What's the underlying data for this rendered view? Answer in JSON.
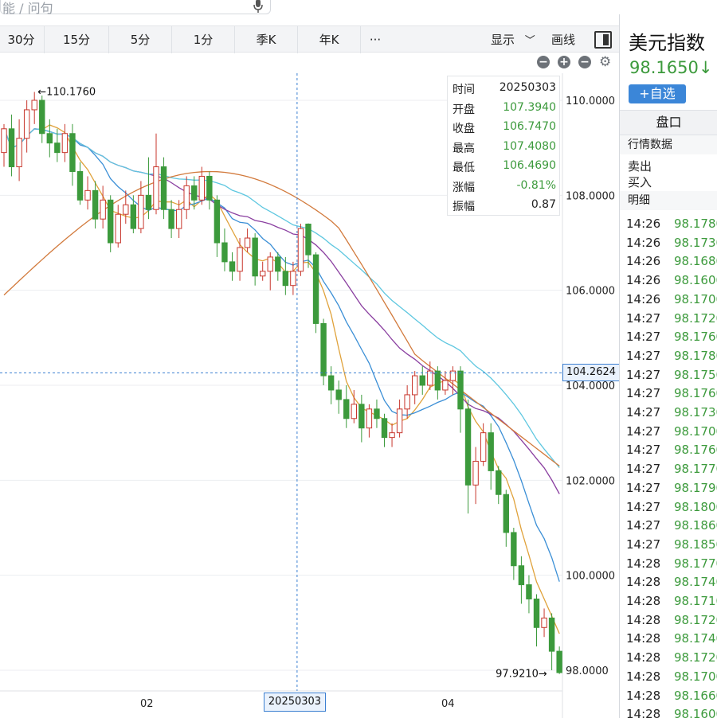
{
  "search": {
    "placeholder": "能 / 问句"
  },
  "toolbar": {
    "periods": [
      "30分",
      "15分",
      "5分",
      "1分",
      "季K",
      "年K",
      "···"
    ],
    "display_label": "显示",
    "display_arrow": "﹀",
    "draw_label": "画线"
  },
  "zoom_controls": {
    "zoom_out": "−",
    "zoom_in": "+",
    "collapse": "−"
  },
  "instrument": {
    "name": "美元指数",
    "price": "98.1650",
    "arrow": "↓",
    "add_watchlist": "+自选",
    "tab": "盘口",
    "quotes_section": "行情数据",
    "sell_label": "卖出",
    "buy_label": "买入",
    "detail_section": "明细"
  },
  "ticks": [
    {
      "time": "14:26",
      "price": "98.1780"
    },
    {
      "time": "14:26",
      "price": "98.1730"
    },
    {
      "time": "14:26",
      "price": "98.1680"
    },
    {
      "time": "14:26",
      "price": "98.1600"
    },
    {
      "time": "14:26",
      "price": "98.1700"
    },
    {
      "time": "14:27",
      "price": "98.1720"
    },
    {
      "time": "14:27",
      "price": "98.1760"
    },
    {
      "time": "14:27",
      "price": "98.1780"
    },
    {
      "time": "14:27",
      "price": "98.1750"
    },
    {
      "time": "14:27",
      "price": "98.1760"
    },
    {
      "time": "14:27",
      "price": "98.1730"
    },
    {
      "time": "14:27",
      "price": "98.1700"
    },
    {
      "time": "14:27",
      "price": "98.1760"
    },
    {
      "time": "14:27",
      "price": "98.1770"
    },
    {
      "time": "14:27",
      "price": "98.1790"
    },
    {
      "time": "14:27",
      "price": "98.1800"
    },
    {
      "time": "14:27",
      "price": "98.1860"
    },
    {
      "time": "14:27",
      "price": "98.1850"
    },
    {
      "time": "14:28",
      "price": "98.1770"
    },
    {
      "time": "14:28",
      "price": "98.1740"
    },
    {
      "time": "14:28",
      "price": "98.1710"
    },
    {
      "time": "14:28",
      "price": "98.1720"
    },
    {
      "time": "14:28",
      "price": "98.1740"
    },
    {
      "time": "14:28",
      "price": "98.1720"
    },
    {
      "time": "14:28",
      "price": "98.1700"
    },
    {
      "time": "14:28",
      "price": "98.1660"
    },
    {
      "time": "14:28",
      "price": "98.1600"
    }
  ],
  "info_box": {
    "rows": [
      {
        "label": "时间",
        "value": "20250303"
      },
      {
        "label": "开盘",
        "value": "107.3940"
      },
      {
        "label": "收盘",
        "value": "106.7470"
      },
      {
        "label": "最高",
        "value": "107.4080"
      },
      {
        "label": "最低",
        "value": "106.4690"
      },
      {
        "label": "涨幅",
        "value": "-0.81%"
      },
      {
        "label": "振幅",
        "value": "0.87"
      }
    ]
  },
  "crosshair": {
    "price": "104.2624",
    "date": "20250303",
    "price_value": 104.2624
  },
  "colors": {
    "up": "#c8372d",
    "down": "#3c9a3c",
    "ma5": "#e0a23b",
    "ma10": "#3b8fd6",
    "ma20": "#8a3fa0",
    "ma30": "#5ec7e0",
    "ma60": "#d27a3c",
    "accent": "#3b86d8"
  },
  "chart_data": {
    "type": "candlestick",
    "y_axis_labels": [
      "110.0000",
      "108.0000",
      "106.0000",
      "104.0000",
      "102.0000",
      "100.0000",
      "98.0000"
    ],
    "ylim": [
      97.5,
      110.6
    ],
    "x_axis_labels": [
      "02",
      "04"
    ],
    "high_annotation": "←110.1760",
    "low_annotation": "97.9210→",
    "high_value": 110.176,
    "low_value": 97.921,
    "candles": [
      [
        108.9,
        109.4,
        109.5,
        108.6
      ],
      [
        109.4,
        108.6,
        109.7,
        108.4
      ],
      [
        108.6,
        109.2,
        109.6,
        108.3
      ],
      [
        109.2,
        109.8,
        110.0,
        108.9
      ],
      [
        109.8,
        110.0,
        110.176,
        109.5
      ],
      [
        110.0,
        109.3,
        110.1,
        109.1
      ],
      [
        109.3,
        109.1,
        109.6,
        108.8
      ],
      [
        109.1,
        108.9,
        109.4,
        108.7
      ],
      [
        108.9,
        109.3,
        109.5,
        108.7
      ],
      [
        109.3,
        108.5,
        109.5,
        108.2
      ],
      [
        108.5,
        107.9,
        108.7,
        107.8
      ],
      [
        107.9,
        108.1,
        108.4,
        107.7
      ],
      [
        108.1,
        107.5,
        108.3,
        107.3
      ],
      [
        107.5,
        107.9,
        108.2,
        107.3
      ],
      [
        107.9,
        107.0,
        108.0,
        106.8
      ],
      [
        107.0,
        107.6,
        107.8,
        106.9
      ],
      [
        107.6,
        107.8,
        108.1,
        107.4
      ],
      [
        107.8,
        107.3,
        108.0,
        107.2
      ],
      [
        107.3,
        108.0,
        108.3,
        107.2
      ],
      [
        108.0,
        107.7,
        108.8,
        107.5
      ],
      [
        107.7,
        108.6,
        109.3,
        107.6
      ],
      [
        108.6,
        107.7,
        108.8,
        107.5
      ],
      [
        107.7,
        107.3,
        107.9,
        107.1
      ],
      [
        107.3,
        107.7,
        107.9,
        107.1
      ],
      [
        107.7,
        108.2,
        108.4,
        107.5
      ],
      [
        108.2,
        107.9,
        108.4,
        107.7
      ],
      [
        107.9,
        108.4,
        108.6,
        107.8
      ],
      [
        108.4,
        107.9,
        108.5,
        107.7
      ],
      [
        107.9,
        107.0,
        108.0,
        106.7
      ],
      [
        107.0,
        106.6,
        107.3,
        106.4
      ],
      [
        106.6,
        106.4,
        106.8,
        106.2
      ],
      [
        106.4,
        106.9,
        107.1,
        106.2
      ],
      [
        106.9,
        107.1,
        107.3,
        106.8
      ],
      [
        107.1,
        106.3,
        107.2,
        106.1
      ],
      [
        106.3,
        106.4,
        106.6,
        106.2
      ],
      [
        106.4,
        106.7,
        106.8,
        106.0
      ],
      [
        106.7,
        106.4,
        106.8,
        106.2
      ],
      [
        106.4,
        106.1,
        106.7,
        105.9
      ],
      [
        106.1,
        106.4,
        106.6,
        105.9
      ],
      [
        106.4,
        107.3,
        107.4,
        106.3
      ],
      [
        107.394,
        106.747,
        107.408,
        106.469
      ],
      [
        106.747,
        105.3,
        106.8,
        105.1
      ],
      [
        105.3,
        104.2,
        105.4,
        104.0
      ],
      [
        104.2,
        103.9,
        104.4,
        103.6
      ],
      [
        103.9,
        103.7,
        104.1,
        103.4
      ],
      [
        103.7,
        103.3,
        104.0,
        103.1
      ],
      [
        103.3,
        103.6,
        103.9,
        103.2
      ],
      [
        103.6,
        103.1,
        103.8,
        102.8
      ],
      [
        103.1,
        103.5,
        103.6,
        102.9
      ],
      [
        103.5,
        103.3,
        103.7,
        103.1
      ],
      [
        103.3,
        102.9,
        103.4,
        102.7
      ],
      [
        102.9,
        103.0,
        103.2,
        102.7
      ],
      [
        103.0,
        103.5,
        103.7,
        102.9
      ],
      [
        103.5,
        103.8,
        104.0,
        103.3
      ],
      [
        103.8,
        104.2,
        104.3,
        103.6
      ],
      [
        104.2,
        104.0,
        104.4,
        103.8
      ],
      [
        104.0,
        104.3,
        104.5,
        103.9
      ],
      [
        104.3,
        103.9,
        104.4,
        103.7
      ],
      [
        103.9,
        104.1,
        104.3,
        103.8
      ],
      [
        104.1,
        104.3,
        104.4,
        103.8
      ],
      [
        104.3,
        103.5,
        104.4,
        103.0
      ],
      [
        103.5,
        101.9,
        103.7,
        101.3
      ],
      [
        101.9,
        102.4,
        102.7,
        101.5
      ],
      [
        102.4,
        103.0,
        103.2,
        102.3
      ],
      [
        103.0,
        102.2,
        103.2,
        101.8
      ],
      [
        102.2,
        101.7,
        102.3,
        101.5
      ],
      [
        101.7,
        100.9,
        101.8,
        100.6
      ],
      [
        100.9,
        100.2,
        101.0,
        99.9
      ],
      [
        100.2,
        99.8,
        100.4,
        99.4
      ],
      [
        99.8,
        99.5,
        100.0,
        99.2
      ],
      [
        99.5,
        98.9,
        99.6,
        98.5
      ],
      [
        98.9,
        99.1,
        99.3,
        98.7
      ],
      [
        99.1,
        98.4,
        99.2,
        98.0
      ],
      [
        98.4,
        97.95,
        98.5,
        97.921
      ]
    ],
    "candles_format": "open, close, high, low"
  }
}
